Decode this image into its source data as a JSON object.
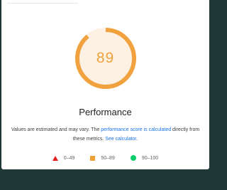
{
  "score": {
    "value": "89",
    "fraction": 0.89,
    "ring_color": "#f2a13f",
    "track_color": "#fdf1e3"
  },
  "category": {
    "title": "Performance"
  },
  "description": {
    "text_before": "Values are estimated and may vary. The ",
    "link_perf_score": "performance score is calculated",
    "text_middle": " directly from these metrics. ",
    "link_calculator": "See calculator",
    "text_after": "."
  },
  "legend": {
    "fail": {
      "range": "0–49",
      "icon": "red-triangle-icon",
      "color": "#e02020"
    },
    "average": {
      "range": "50–89",
      "icon": "orange-square-icon",
      "color": "#f0a137"
    },
    "pass": {
      "range": "90–100",
      "icon": "green-circle-icon",
      "color": "#0cce6b"
    }
  }
}
